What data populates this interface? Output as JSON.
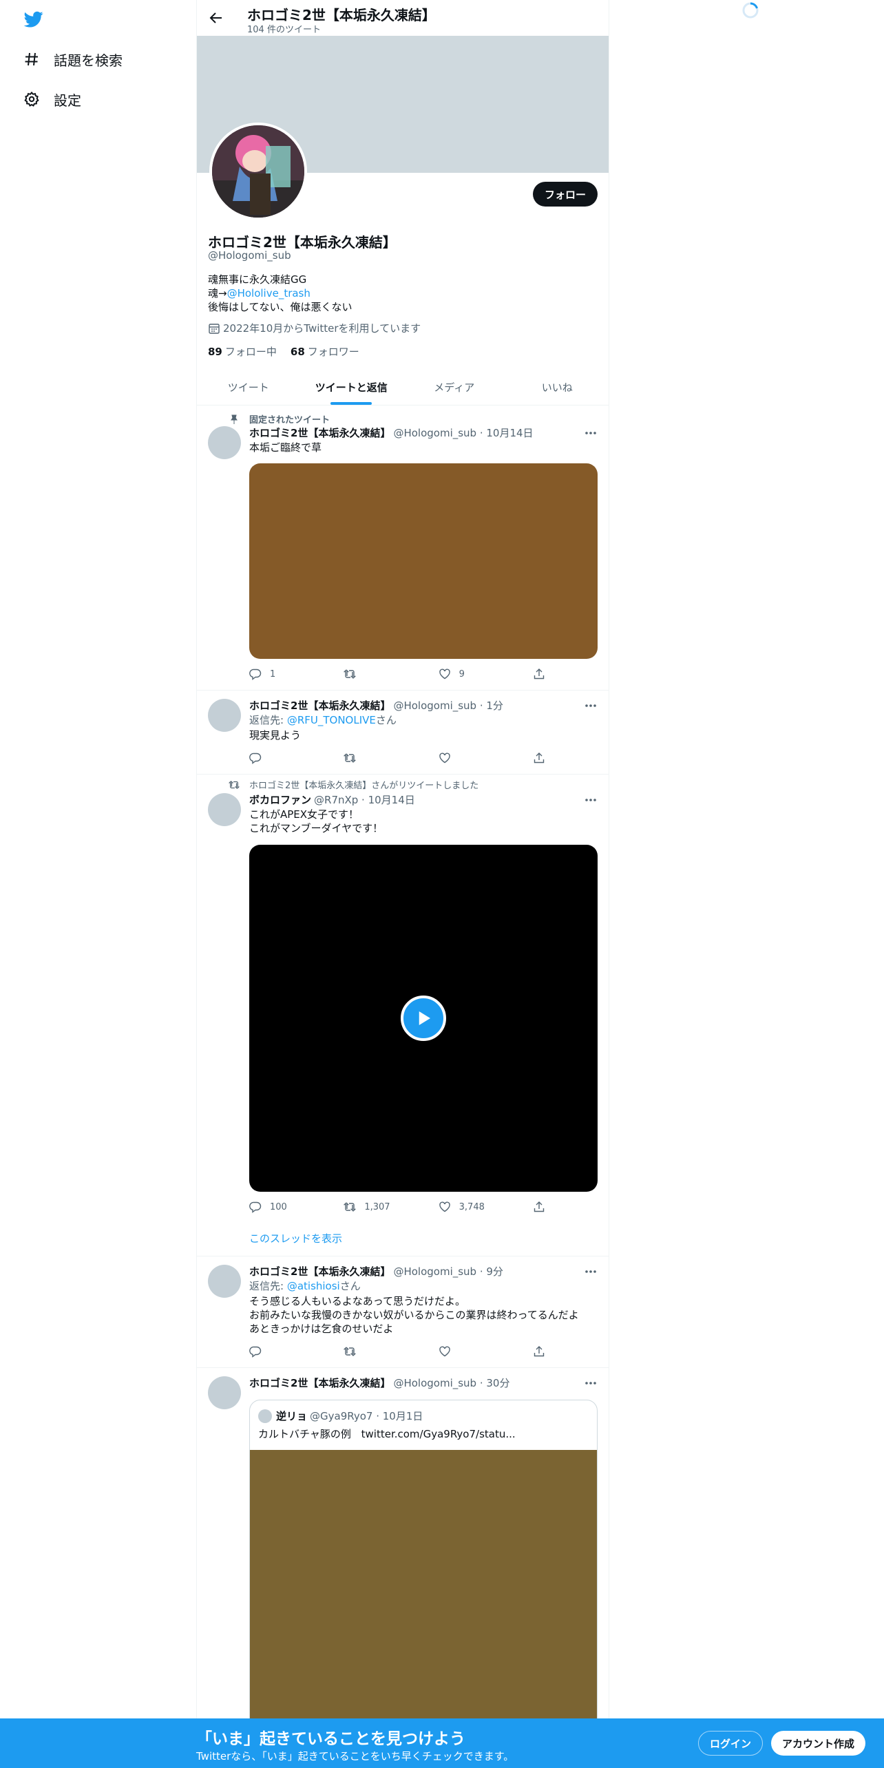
{
  "sidebar": {
    "items": [
      {
        "label": "話題を検索",
        "icon": "hashtag-icon"
      },
      {
        "label": "設定",
        "icon": "gear-icon"
      }
    ]
  },
  "header": {
    "title": "ホロゴミ2世【本垢永久凍結】",
    "tweet_count": "104 件のツイート"
  },
  "profile": {
    "name": "ホロゴミ2世【本垢永久凍結】",
    "handle": "@Hologomi_sub",
    "follow_label": "フォロー",
    "bio_line1": "魂無事に永久凍結GG",
    "bio_line2_prefix": "魂→",
    "bio_line2_link": "@Hololive_trash",
    "bio_line3": "後悔はしてない、俺は悪くない",
    "joined": "2022年10月からTwitterを利用しています",
    "following_count": "89",
    "following_label": "フォロー中",
    "followers_count": "68",
    "followers_label": "フォロワー"
  },
  "tabs": [
    {
      "label": "ツイート"
    },
    {
      "label": "ツイートと返信"
    },
    {
      "label": "メディア"
    },
    {
      "label": "いいね"
    }
  ],
  "tweets": [
    {
      "context": "固定されたツイート",
      "name": "ホロゴミ2世【本垢永久凍結】",
      "meta": "@Hologomi_sub · 10月14日",
      "text": "本垢ご臨終で草",
      "media_color": "#855a28",
      "replies": "1",
      "retweets": "",
      "likes": "9"
    },
    {
      "name": "ホロゴミ2世【本垢永久凍結】",
      "meta": "@Hologomi_sub · 1分",
      "reply_prefix": "返信先: ",
      "reply_to": "@RFU_TONOLIVE",
      "reply_suffix": "さん",
      "text": "現実見よう"
    },
    {
      "context": "ホロゴミ2世【本垢永久凍結】さんがリツイートしました",
      "name": "ボカロファン",
      "meta": "@R7nXp · 10月14日",
      "text_line1": "これがAPEX女子です！",
      "text_line2": "これがマンブーダイヤです！",
      "replies": "100",
      "retweets": "1,307",
      "likes": "3,748",
      "thread_link": "このスレッドを表示"
    },
    {
      "name": "ホロゴミ2世【本垢永久凍結】",
      "meta": "@Hologomi_sub · 9分",
      "reply_prefix": "返信先: ",
      "reply_to": "@atishiosi",
      "reply_suffix": "さん",
      "text_line1": "そう感じる人もいるよなあって思うだけだよ。",
      "text_line2": "お前みたいな我慢のきかない奴がいるからこの業界は終わってるんだよ",
      "text_line3": "あときっかけは乞食のせいだよ"
    },
    {
      "name": "ホロゴミ2世【本垢永久凍結】",
      "meta": "@Hologomi_sub · 30分",
      "quote_name": "逆リョ",
      "quote_meta": "@Gya9Ryo7 · 10月1日",
      "quote_text": "カルトバチャ豚の例",
      "quote_link": "twitter.com/Gya9Ryo7/statu...",
      "media_color": "#7b6432"
    }
  ],
  "bottom_bar": {
    "title": "「いま」起きていることを見つけよう",
    "subtitle": "Twitterなら、「いま」起きていることをいち早くチェックできます。",
    "login": "ログイン",
    "signup": "アカウント作成"
  }
}
